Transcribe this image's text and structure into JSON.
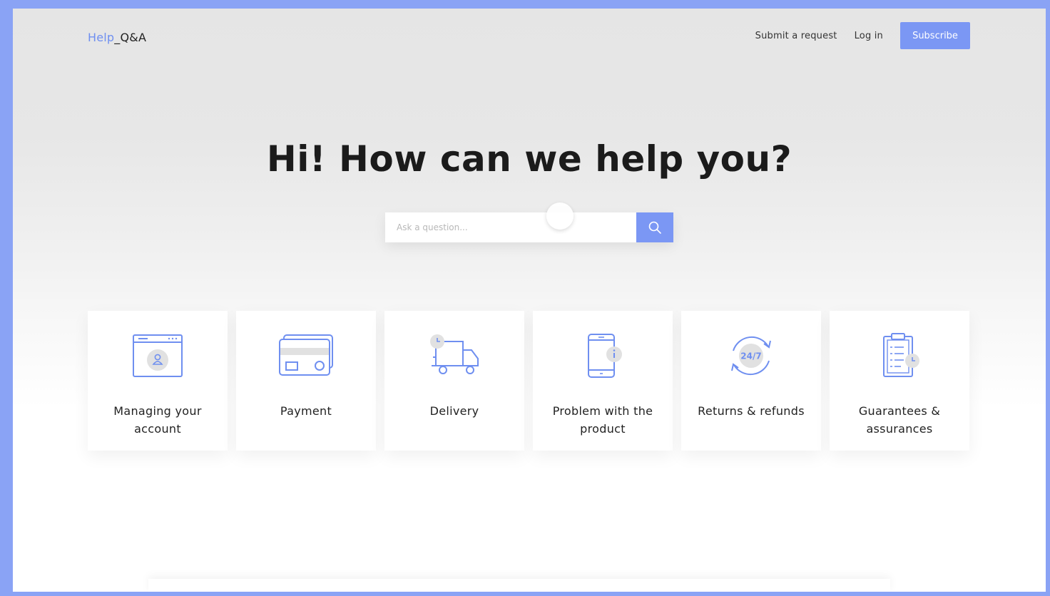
{
  "header": {
    "logo_help": "Help",
    "logo_rest": "_Q&A",
    "nav": [
      {
        "label": "Submit a request"
      },
      {
        "label": "Log in"
      }
    ],
    "subscribe_label": "Subscribe"
  },
  "hero": {
    "title": "Hi! How can we help you?"
  },
  "search": {
    "placeholder": "Ask a question...",
    "value": ""
  },
  "categories": [
    {
      "label": "Managing your account",
      "icon": "account-window-icon"
    },
    {
      "label": "Payment",
      "icon": "credit-cards-icon"
    },
    {
      "label": "Delivery",
      "icon": "delivery-truck-icon"
    },
    {
      "label": "Problem with the product",
      "icon": "phone-info-icon"
    },
    {
      "label": "Returns & refunds",
      "icon": "returns-24-7-icon"
    },
    {
      "label": "Guarantees & assurances",
      "icon": "clipboard-checklist-icon"
    }
  ],
  "icon_badge_text": "24/7",
  "colors": {
    "accent": "#7b97f4",
    "outer_frame": "#8aa3f5",
    "text": "#1b1b1b"
  }
}
